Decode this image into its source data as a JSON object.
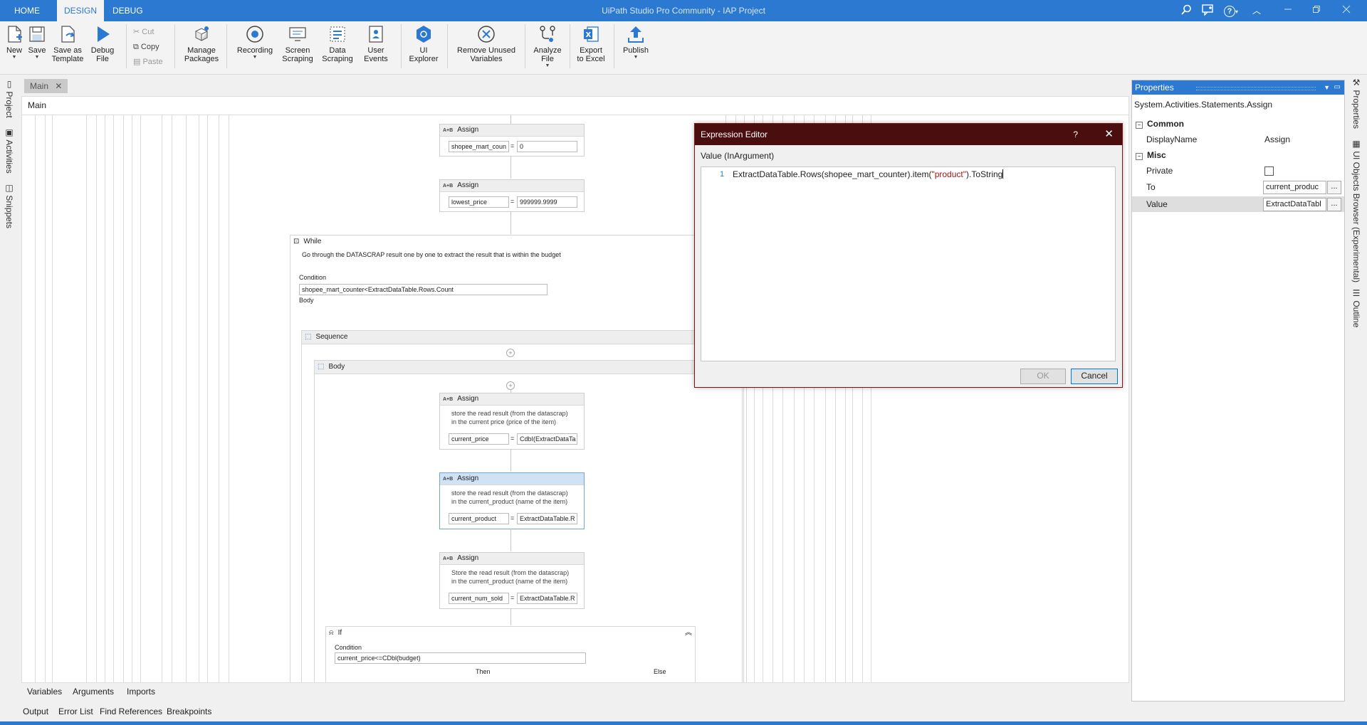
{
  "titlebar": {
    "tabs": [
      "HOME",
      "DESIGN",
      "DEBUG"
    ],
    "active_tab": "DESIGN",
    "window_title": "UiPath Studio Pro Community - IAP Project",
    "help_label": "?"
  },
  "ribbon": {
    "new": {
      "label": "New",
      "has_dropdown": true
    },
    "save": {
      "label": "Save",
      "has_dropdown": true
    },
    "save_as_template": {
      "label": "Save as\nTemplate"
    },
    "debug_file": {
      "label": "Debug\nFile",
      "has_dropdown": true
    },
    "cut": "Cut",
    "copy": "Copy",
    "paste": "Paste",
    "manage_packages": "Manage\nPackages",
    "recording": "Recording",
    "screen_scraping": "Screen\nScraping",
    "data_scraping": "Data\nScraping",
    "user_events": "User\nEvents",
    "ui_explorer": "UI\nExplorer",
    "remove_unused_variables": "Remove Unused\nVariables",
    "analyze_file": "Analyze\nFile",
    "export_to_excel": "Export\nto Excel",
    "publish": "Publish",
    "colors": {
      "accent": "#2b79d0",
      "publish_icon": "#2b79d0"
    }
  },
  "left_panels": [
    "Project",
    "Activities",
    "Snippets"
  ],
  "right_panels": [
    "Properties",
    "UI Objects Browser (Experimental)",
    "Outline"
  ],
  "designer": {
    "doc_tab": "Main",
    "breadcrumb": "Main",
    "assign1": {
      "title": "Assign",
      "to": "shopee_mart_coun",
      "value": "0"
    },
    "assign2": {
      "title": "Assign",
      "to": "lowest_price",
      "value": "999999.9999"
    },
    "while": {
      "title": "While",
      "description": "Go through the DATASCRAP result one by one to extract the result that is within the budget",
      "condition_label": "Condition",
      "condition": "shopee_mart_counter<ExtractDataTable.Rows.Count",
      "body_label": "Body"
    },
    "sequence": {
      "title": "Sequence"
    },
    "body": {
      "title": "Body"
    },
    "assign3": {
      "title": "Assign",
      "description": "store the read result (from the datascrap)\nin the current price (price of the item)",
      "to": "current_price",
      "value": "CdbI(ExtractDataTa"
    },
    "assign4": {
      "title": "Assign",
      "description": "store the read result (from the datascrap)\nin the current_product (name of the item)",
      "to": "current_product",
      "value": "ExtractDataTable.R"
    },
    "assign5": {
      "title": "Assign",
      "description": "Store the read result (from the datascrap)\nin the current_product (name of the item)",
      "to": "current_num_sold",
      "value": "ExtractDataTable.R"
    },
    "if": {
      "title": "If",
      "condition_label": "Condition",
      "condition": "current_price<=CDbl(budget)",
      "then_label": "Then",
      "else_label": "Else"
    }
  },
  "designer_tabs": [
    "Variables",
    "Arguments",
    "Imports"
  ],
  "bottom_tabs": [
    "Output",
    "Error List",
    "Find References",
    "Breakpoints"
  ],
  "properties": {
    "title": "Properties",
    "type_name": "System.Activities.Statements.Assign",
    "categories": {
      "common": "Common",
      "misc": "Misc"
    },
    "rows": {
      "display_name": {
        "label": "DisplayName",
        "value": "Assign"
      },
      "private": {
        "label": "Private",
        "checked": false
      },
      "to": {
        "label": "To",
        "value": "current_produc"
      },
      "value": {
        "label": "Value",
        "value": "ExtractDataTabl"
      }
    },
    "dots_label": "..."
  },
  "expression_editor": {
    "title": "Expression Editor",
    "help": "?",
    "value_label": "Value (InArgument)",
    "line_number": "1",
    "code_before": "ExtractDataTable.Rows(shopee_mart_counter).item(",
    "code_string": "\"product\"",
    "code_after": ").ToString",
    "ok_label": "OK",
    "cancel_label": "Cancel",
    "colors": {
      "header": "#4a0e0e",
      "string": "#a31515"
    }
  }
}
